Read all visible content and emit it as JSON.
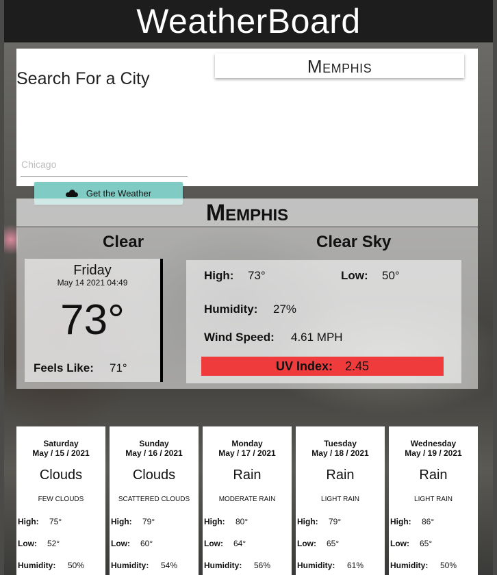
{
  "header": {
    "title": "WeatherBoard"
  },
  "search": {
    "title": "Search For a City",
    "placeholder": "Chicago",
    "button_label": "Get the Weather",
    "button_icon": "cloud-icon",
    "history": [
      "Memphis"
    ]
  },
  "current": {
    "city": "Memphis",
    "main": "Clear",
    "description": "Clear Sky",
    "day": "Friday",
    "date": "May 14 2021 04:49",
    "temp": "73°",
    "feels_label": "Feels Like:",
    "feels_value": "71°",
    "high_label": "High:",
    "high_value": "73°",
    "low_label": "Low:",
    "low_value": "50°",
    "humidity_label": "Humidity:",
    "humidity_value": "27%",
    "wind_label": "Wind Speed:",
    "wind_value": "4.61 MPH",
    "uv_label": "UV Index:",
    "uv_value": "2.45",
    "uv_color": "#ef3b3b"
  },
  "forecast": [
    {
      "day": "Saturday",
      "date": "May / 15 / 2021",
      "main": "Clouds",
      "desc": "few clouds",
      "high": "75°",
      "low": "52°",
      "humidity": "50%"
    },
    {
      "day": "Sunday",
      "date": "May / 16 / 2021",
      "main": "Clouds",
      "desc": "scattered clouds",
      "high": "79°",
      "low": "60°",
      "humidity": "54%"
    },
    {
      "day": "Monday",
      "date": "May / 17 / 2021",
      "main": "Rain",
      "desc": "moderate rain",
      "high": "80°",
      "low": "64°",
      "humidity": "56%"
    },
    {
      "day": "Tuesday",
      "date": "May / 18 / 2021",
      "main": "Rain",
      "desc": "light rain",
      "high": "79°",
      "low": "65°",
      "humidity": "61%"
    },
    {
      "day": "Wednesday",
      "date": "May / 19 / 2021",
      "main": "Rain",
      "desc": "light rain",
      "high": "86°",
      "low": "65°",
      "humidity": "50%"
    }
  ],
  "forecast_labels": {
    "high": "High:",
    "low": "Low:",
    "humidity": "Humidity:"
  },
  "colors": {
    "header_bg": "#1d1d1d",
    "button_bg": "#80cbc4",
    "uv_bar": "#ef3b3b"
  }
}
